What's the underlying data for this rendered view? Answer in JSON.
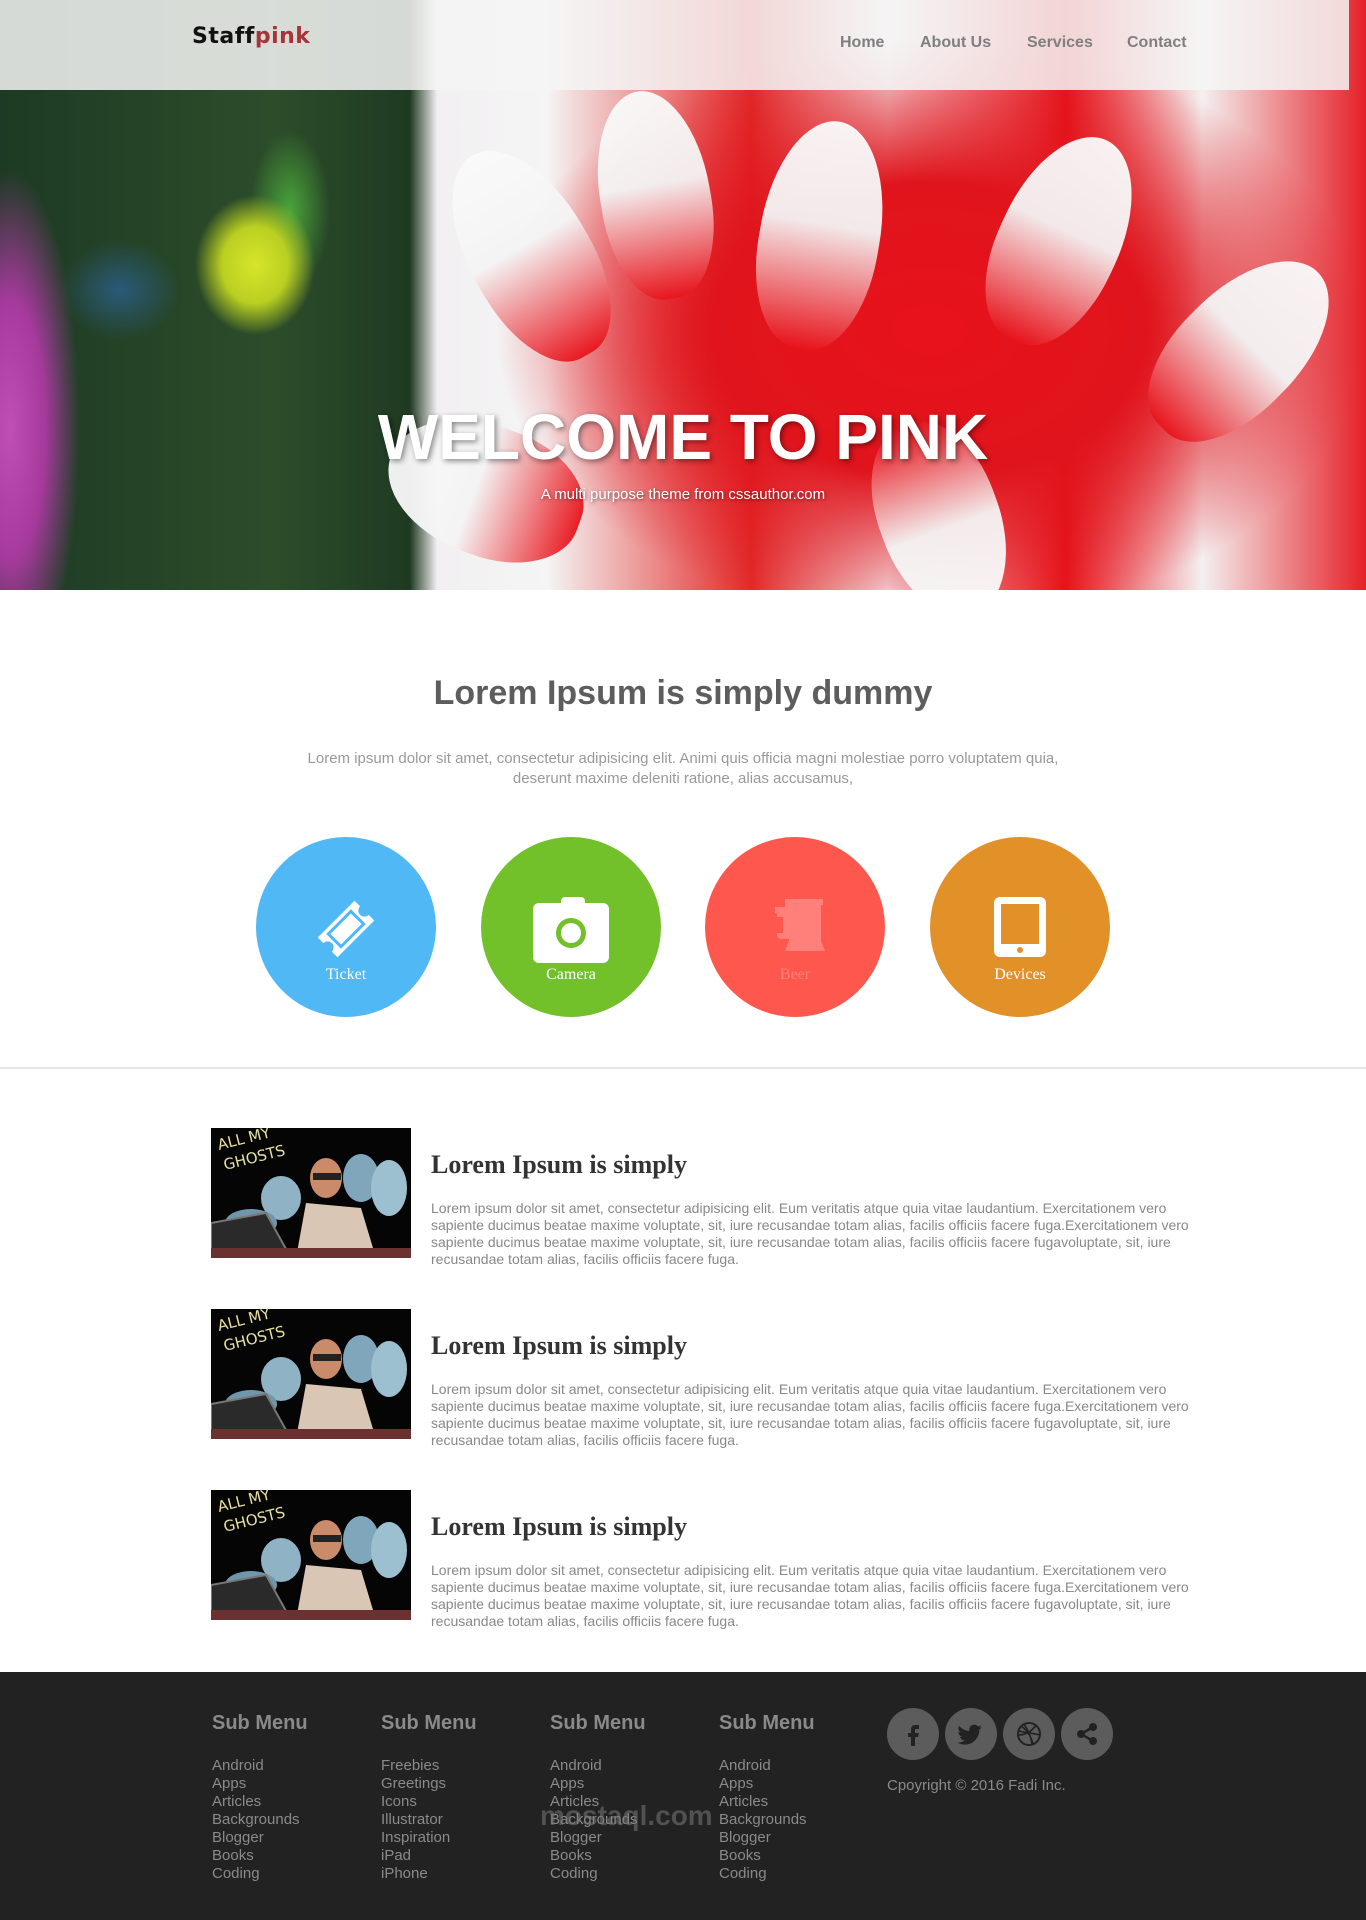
{
  "header": {
    "logo_main": "Staff",
    "logo_accent": "pink",
    "nav": [
      {
        "label": "Home"
      },
      {
        "label": "About Us"
      },
      {
        "label": "Services"
      },
      {
        "label": "Contact"
      }
    ]
  },
  "hero": {
    "title": "WELCOME TO PINK",
    "subtitle": "A multi purpose theme from cssauthor.com"
  },
  "intro": {
    "title": "Lorem Ipsum is simply dummy",
    "text": "Lorem ipsum dolor sit amet, consectetur adipisicing elit. Animi quis officia magni molestiae porro voluptatem quia, deserunt maxime deleniti ratione, alias accusamus,"
  },
  "features": [
    {
      "label": "Ticket",
      "icon": "ticket-icon",
      "color": "#4fb8f5"
    },
    {
      "label": "Camera",
      "icon": "camera-icon",
      "color": "#72c02a"
    },
    {
      "label": "Beer",
      "icon": "beer-icon",
      "color": "#fd574e"
    },
    {
      "label": "Devices",
      "icon": "tablet-icon",
      "color": "#e29028"
    }
  ],
  "articles": [
    {
      "image_caption": "ALL MY GHOSTS",
      "title": "Lorem Ipsum is simply",
      "text": "Lorem ipsum dolor sit amet, consectetur adipisicing elit. Eum veritatis atque quia vitae laudantium. Exercitationem vero sapiente ducimus beatae maxime voluptate, sit, iure recusandae totam alias, facilis officiis facere fuga.Exercitationem vero sapiente ducimus beatae maxime voluptate, sit, iure recusandae totam alias, facilis officiis facere fugavoluptate, sit, iure recusandae totam alias, facilis officiis facere fuga."
    },
    {
      "image_caption": "ALL MY GHOSTS",
      "title": "Lorem Ipsum is simply",
      "text": "Lorem ipsum dolor sit amet, consectetur adipisicing elit. Eum veritatis atque quia vitae laudantium. Exercitationem vero sapiente ducimus beatae maxime voluptate, sit, iure recusandae totam alias, facilis officiis facere fuga.Exercitationem vero sapiente ducimus beatae maxime voluptate, sit, iure recusandae totam alias, facilis officiis facere fugavoluptate, sit, iure recusandae totam alias, facilis officiis facere fuga."
    },
    {
      "image_caption": "ALL MY GHOSTS",
      "title": "Lorem Ipsum is simply",
      "text": "Lorem ipsum dolor sit amet, consectetur adipisicing elit. Eum veritatis atque quia vitae laudantium. Exercitationem vero sapiente ducimus beatae maxime voluptate, sit, iure recusandae totam alias, facilis officiis facere fuga.Exercitationem vero sapiente ducimus beatae maxime voluptate, sit, iure recusandae totam alias, facilis officiis facere fugavoluptate, sit, iure recusandae totam alias, facilis officiis facere fuga."
    }
  ],
  "footer": {
    "columns": [
      {
        "title": "Sub Menu",
        "links": [
          "Android",
          "Apps",
          "Articles",
          "Backgrounds",
          "Blogger",
          "Books",
          "Coding"
        ]
      },
      {
        "title": "Sub Menu",
        "links": [
          "Freebies",
          "Greetings",
          "Icons",
          "Illustrator",
          "Inspiration",
          "iPad",
          "iPhone"
        ]
      },
      {
        "title": "Sub Menu",
        "links": [
          "Android",
          "Apps",
          "Articles",
          "Backgrounds",
          "Blogger",
          "Books",
          "Coding"
        ]
      },
      {
        "title": "Sub Menu",
        "links": [
          "Android",
          "Apps",
          "Articles",
          "Backgrounds",
          "Blogger",
          "Books",
          "Coding"
        ]
      }
    ],
    "social": [
      {
        "icon": "facebook-icon"
      },
      {
        "icon": "twitter-icon"
      },
      {
        "icon": "dribbble-icon"
      },
      {
        "icon": "share-icon"
      }
    ],
    "copyright": "Cpoyright © 2016 Fadi Inc.",
    "watermark": "mostaql.com"
  }
}
